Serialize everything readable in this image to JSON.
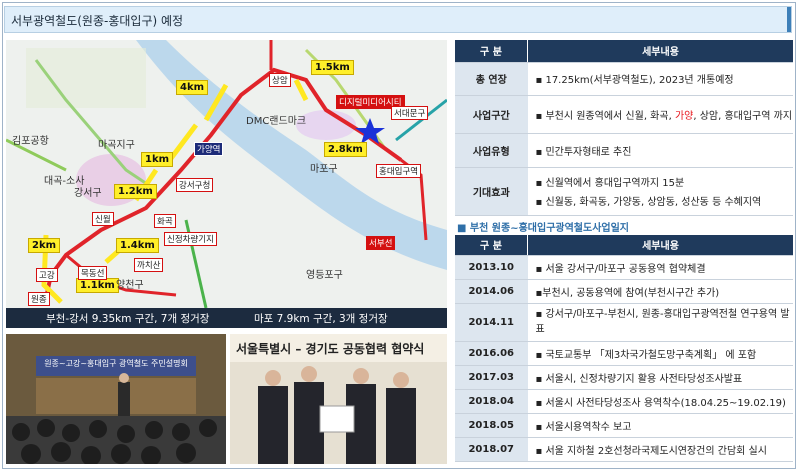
{
  "title": "서부광역철도(원종-홍대입구) 예정",
  "map": {
    "caption_left": "부천-강서 9.35km 구간, 7개 정거장",
    "caption_right": "마포 7.9km 구간, 3개 정거장",
    "distances": [
      "1.5km",
      "4km",
      "1km",
      "1.2km",
      "2.8km",
      "2km",
      "1.4km",
      "1.1km"
    ],
    "stations": [
      "상암",
      "디지털미디어시티",
      "가양역",
      "홍대입구역",
      "신월",
      "화곡",
      "신정차량기지",
      "강서구청",
      "까치산",
      "고강",
      "원종",
      "목동선",
      "서부선",
      "서대문구"
    ],
    "places": [
      "마곡지구",
      "강서구",
      "양천구",
      "마포구",
      "영등포구",
      "김포공항",
      "DMC랜드마크",
      "대곡-소사"
    ]
  },
  "photo1": {
    "banner": "원종~고강~홍대입구 광역철도 주민설명회"
  },
  "photo2": {
    "banner": "서울특별시 – 경기도 공동협력 협약식"
  },
  "overview": {
    "header": [
      "구 분",
      "세부내용"
    ],
    "rows": [
      {
        "key": "총 연장",
        "value": "▪ 17.25km(서부광역철도), 2023년 개통예정"
      },
      {
        "key": "사업구간",
        "value_pre": "▪ 부천시 원종역에서 신월, 화곡, ",
        "value_hl": "가양",
        "value_post": ", 상암, 홍대입구역 까지"
      },
      {
        "key": "사업유형",
        "value": "▪ 민간투자형태로 추진"
      },
      {
        "key": "기대효과",
        "value": "▪ 신월역에서 홍대입구역까지 15분",
        "value2": "▪ 신월동, 화곡동, 가양동, 상암동, 성산동 등 수혜지역"
      }
    ]
  },
  "section_title": "■ 부천 원종~홍대입구광역철도사업일지",
  "history": {
    "header": [
      "구 분",
      "세부내용"
    ],
    "rows": [
      {
        "date": "2013.10",
        "text": "▪ 서울 강서구/마포구 공동용역 협약체결"
      },
      {
        "date": "2014.06",
        "text": "▪부천시, 공동용역에 참여(부천시구간 추가)"
      },
      {
        "date": "2014.11",
        "text": "▪ 강서구/마포구-부천시, 원종-홍대입구광역전철 연구용역 발표"
      },
      {
        "date": "2016.06",
        "text": "▪ 국토교통부 「제3차국가철도망구축계획」 에 포함"
      },
      {
        "date": "2017.03",
        "text": "▪ 서울시, 신정차량기지 활용 사전타당성조사발표"
      },
      {
        "date": "2018.04",
        "text": "▪ 서울시 사전타당성조사 용역착수(18.04.25~19.02.19)"
      },
      {
        "date": "2018.05",
        "text": "▪ 서울시용역착수 보고"
      },
      {
        "date": "2018.07",
        "text": "▪ 서울 지하철 2호선청라국제도시연장건의 간담회 실시"
      }
    ]
  },
  "colors": {
    "header": "#1f3a5c",
    "key_bg": "#dde6ef",
    "highlight": "#e8141b",
    "route": "#e0242a",
    "dist_box": "#ffef2a"
  }
}
